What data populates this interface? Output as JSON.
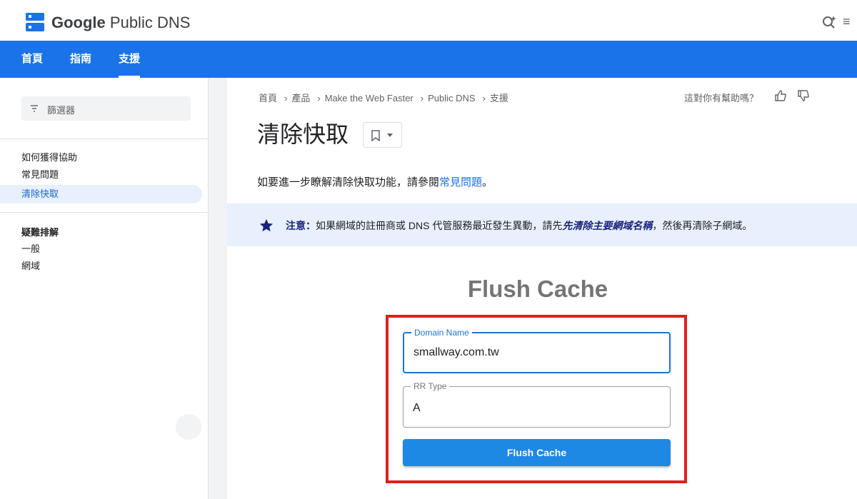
{
  "header": {
    "brand_google": "Google",
    "brand_product": "Public DNS"
  },
  "nav": {
    "tabs": [
      {
        "label": "首頁"
      },
      {
        "label": "指南"
      },
      {
        "label": "支援",
        "active": true
      }
    ]
  },
  "sidebar": {
    "filter_placeholder": "篩選器",
    "items": [
      {
        "label": "如何獲得協助"
      },
      {
        "label": "常見問題"
      },
      {
        "label": "清除快取",
        "active": true
      }
    ],
    "section_heading": "疑難排解",
    "section_items": [
      {
        "label": "一般"
      },
      {
        "label": "網域"
      }
    ]
  },
  "breadcrumb": [
    "首頁",
    "產品",
    "Make the Web Faster",
    "Public DNS",
    "支援"
  ],
  "helpful_prompt": "這對你有幫助嗎？",
  "page": {
    "title": "清除快取",
    "intro_prefix": "如要進一步瞭解清除快取功能，請參閱",
    "intro_link": "常見問題",
    "intro_suffix": "。"
  },
  "notice": {
    "label": "注意：",
    "text_before": "如果網域的註冊商或 DNS 代管服務最近發生異動，請先",
    "emphasis": "先清除主要網域名稱",
    "text_after": "，然後再清除子網域。"
  },
  "tool": {
    "title": "Flush Cache",
    "domain_label": "Domain Name",
    "domain_value": "smallway.com.tw",
    "rr_label": "RR Type",
    "rr_value": "A",
    "button_label": "Flush Cache"
  },
  "colors": {
    "brand_blue": "#1a73e8",
    "highlight_red": "#e21d1d",
    "button_blue": "#1e88e5"
  }
}
